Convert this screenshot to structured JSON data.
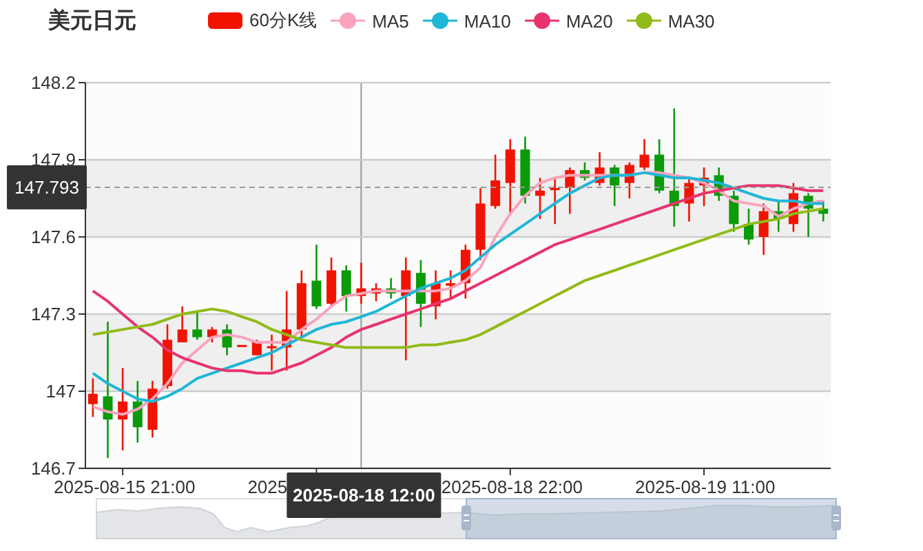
{
  "title": "美元日元",
  "candle_legend": {
    "label": "60分K线"
  },
  "chart": {
    "chart_data": {
      "type": "candlestick",
      "ylim": [
        146.7,
        148.2
      ],
      "yticks": [
        146.7,
        147,
        147.3,
        147.6,
        147.9,
        148.2
      ],
      "grid": true,
      "categories": [
        null,
        null,
        "2025-08-15 21:00",
        null,
        null,
        null,
        null,
        null,
        null,
        null,
        null,
        null,
        null,
        null,
        null,
        null,
        null,
        null,
        null,
        null,
        null,
        null,
        null,
        null,
        null,
        null,
        null,
        null,
        "2025-08-18 22:00",
        null,
        null,
        null,
        null,
        null,
        null,
        null,
        null,
        null,
        null,
        null,
        null,
        "2025-08-19 11:00",
        null,
        null,
        null,
        null,
        null,
        null,
        null,
        null
      ],
      "ohlc": [
        [
          146.95,
          147.05,
          146.9,
          146.99
        ],
        [
          146.98,
          147.27,
          146.74,
          146.89
        ],
        [
          146.89,
          147.09,
          146.77,
          146.96
        ],
        [
          146.96,
          147.04,
          146.8,
          146.86
        ],
        [
          146.85,
          147.04,
          146.82,
          147.01
        ],
        [
          147.02,
          147.26,
          147.01,
          147.2
        ],
        [
          147.19,
          147.33,
          147.19,
          147.24
        ],
        [
          147.24,
          147.31,
          147.2,
          147.21
        ],
        [
          147.21,
          147.25,
          147.19,
          147.24
        ],
        [
          147.24,
          147.26,
          147.14,
          147.17
        ],
        [
          147.18,
          147.18,
          147.18,
          147.18
        ],
        [
          147.14,
          147.2,
          147.14,
          147.19
        ],
        [
          147.17,
          147.22,
          147.08,
          147.175
        ],
        [
          147.17,
          147.39,
          147.08,
          147.24
        ],
        [
          147.24,
          147.47,
          147.21,
          147.42
        ],
        [
          147.43,
          147.57,
          147.32,
          147.33
        ],
        [
          147.34,
          147.52,
          147.33,
          147.47
        ],
        [
          147.47,
          147.49,
          147.31,
          147.37
        ],
        [
          147.37,
          147.5,
          147.34,
          147.4
        ],
        [
          147.38,
          147.42,
          147.35,
          147.4
        ],
        [
          147.4,
          147.44,
          147.36,
          147.38
        ],
        [
          147.37,
          147.52,
          147.12,
          147.47
        ],
        [
          147.46,
          147.51,
          147.25,
          147.34
        ],
        [
          147.33,
          147.47,
          147.28,
          147.42
        ],
        [
          147.41,
          147.47,
          147.36,
          147.42
        ],
        [
          147.42,
          147.57,
          147.36,
          147.55
        ],
        [
          147.55,
          147.79,
          147.51,
          147.73
        ],
        [
          147.72,
          147.92,
          147.71,
          147.82
        ],
        [
          147.81,
          147.98,
          147.69,
          147.94
        ],
        [
          147.94,
          147.99,
          147.73,
          147.76
        ],
        [
          147.76,
          147.83,
          147.67,
          147.78
        ],
        [
          147.785,
          147.83,
          147.65,
          147.79
        ],
        [
          147.79,
          147.87,
          147.69,
          147.86
        ],
        [
          147.86,
          147.89,
          147.82,
          147.83
        ],
        [
          147.81,
          147.93,
          147.8,
          147.87
        ],
        [
          147.87,
          147.88,
          147.72,
          147.8
        ],
        [
          147.81,
          147.89,
          147.75,
          147.88
        ],
        [
          147.87,
          147.98,
          147.86,
          147.92
        ],
        [
          147.92,
          147.98,
          147.77,
          147.78
        ],
        [
          147.78,
          148.1,
          147.64,
          147.72
        ],
        [
          147.73,
          147.83,
          147.66,
          147.81
        ],
        [
          147.8,
          147.87,
          147.72,
          147.83
        ],
        [
          147.84,
          147.87,
          147.74,
          147.76
        ],
        [
          147.76,
          147.78,
          147.62,
          147.65
        ],
        [
          147.65,
          147.71,
          147.57,
          147.59
        ],
        [
          147.6,
          147.73,
          147.53,
          147.7
        ],
        [
          147.7,
          147.74,
          147.62,
          147.67
        ],
        [
          147.65,
          147.81,
          147.62,
          147.77
        ],
        [
          147.76,
          147.77,
          147.6,
          147.71
        ],
        [
          147.71,
          147.74,
          147.66,
          147.69
        ]
      ],
      "series": [
        {
          "name": "MA5",
          "type": "line",
          "color": "#f9a3bd",
          "values": [
            146.94,
            146.92,
            146.91,
            146.93,
            146.97,
            147.03,
            147.11,
            147.16,
            147.21,
            147.22,
            147.21,
            147.19,
            147.19,
            147.19,
            147.24,
            147.28,
            147.33,
            147.37,
            147.38,
            147.39,
            147.39,
            147.39,
            147.39,
            147.39,
            147.4,
            147.43,
            147.48,
            147.6,
            147.69,
            147.76,
            147.81,
            147.83,
            147.84,
            147.84,
            147.84,
            147.84,
            147.84,
            147.85,
            147.85,
            147.84,
            147.83,
            147.81,
            147.78,
            147.74,
            147.73,
            147.72,
            147.68,
            147.71,
            147.73,
            147.74
          ]
        },
        {
          "name": "MA10",
          "type": "line",
          "color": "#1fb6d6",
          "values": [
            147.07,
            147.03,
            147,
            146.97,
            146.96,
            146.98,
            147.01,
            147.05,
            147.07,
            147.09,
            147.11,
            147.13,
            147.15,
            147.18,
            147.21,
            147.24,
            147.26,
            147.27,
            147.29,
            147.31,
            147.34,
            147.37,
            147.4,
            147.42,
            147.44,
            147.47,
            147.52,
            147.57,
            147.61,
            147.65,
            147.69,
            147.73,
            147.77,
            147.8,
            147.83,
            147.84,
            147.84,
            147.85,
            147.84,
            147.83,
            147.83,
            147.82,
            147.81,
            147.79,
            147.77,
            147.75,
            147.74,
            147.74,
            147.73,
            147.73
          ]
        },
        {
          "name": "MA20",
          "type": "line",
          "color": "#e8336d",
          "values": [
            147.39,
            147.35,
            147.3,
            147.25,
            147.21,
            147.16,
            147.13,
            147.11,
            147.09,
            147.08,
            147.08,
            147.07,
            147.07,
            147.09,
            147.11,
            147.14,
            147.17,
            147.21,
            147.24,
            147.26,
            147.28,
            147.3,
            147.32,
            147.34,
            147.36,
            147.39,
            147.42,
            147.45,
            147.48,
            147.51,
            147.54,
            147.57,
            147.59,
            147.61,
            147.63,
            147.65,
            147.67,
            147.69,
            147.71,
            147.73,
            147.75,
            147.77,
            147.78,
            147.79,
            147.8,
            147.8,
            147.8,
            147.79,
            147.78,
            147.78
          ]
        },
        {
          "name": "MA30",
          "type": "line",
          "color": "#90bb18",
          "values": [
            147.22,
            147.23,
            147.24,
            147.25,
            147.26,
            147.28,
            147.3,
            147.31,
            147.32,
            147.31,
            147.29,
            147.27,
            147.24,
            147.22,
            147.2,
            147.19,
            147.18,
            147.17,
            147.17,
            147.17,
            147.17,
            147.17,
            147.18,
            147.18,
            147.19,
            147.2,
            147.22,
            147.25,
            147.28,
            147.31,
            147.34,
            147.37,
            147.4,
            147.43,
            147.45,
            147.47,
            147.49,
            147.51,
            147.53,
            147.55,
            147.57,
            147.59,
            147.61,
            147.63,
            147.65,
            147.66,
            147.67,
            147.69,
            147.7,
            147.71
          ]
        }
      ],
      "ref_lines": [
        {
          "axis": "y",
          "value": 147.793,
          "label": "147.793"
        }
      ]
    },
    "covered_axis_label": "2025",
    "crosshair_time_label": "2025-08-18 12:00",
    "range_slider": {
      "level": 0.5
    }
  }
}
